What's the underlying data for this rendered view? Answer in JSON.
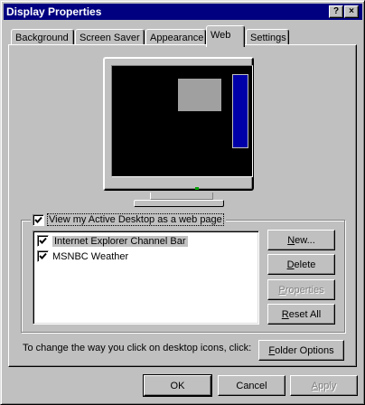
{
  "window": {
    "title": "Display Properties",
    "help_button": "?",
    "close_button": "×"
  },
  "tabs": [
    {
      "label": "Background",
      "active": false
    },
    {
      "label": "Screen Saver",
      "active": false
    },
    {
      "label": "Appearance",
      "active": false
    },
    {
      "label": "Web",
      "active": true
    },
    {
      "label": "Settings",
      "active": false
    }
  ],
  "preview": {
    "screen_color": "#000000",
    "window_color": "#a0a0a0",
    "channel_bar_color": "#0000a8"
  },
  "active_desktop": {
    "checkbox_label": "View my Active Desktop as a web page",
    "checked": true,
    "items": [
      {
        "label": "Internet Explorer Channel Bar",
        "checked": true,
        "selected": true
      },
      {
        "label": "MSNBC Weather",
        "checked": true,
        "selected": false
      }
    ]
  },
  "buttons": {
    "new": "New...",
    "delete": "Delete",
    "properties": "Properties",
    "reset_all": "Reset All",
    "folder_options": "Folder Options"
  },
  "hint_text": "To change the way you click on desktop icons, click:",
  "dialog_buttons": {
    "ok": "OK",
    "cancel": "Cancel",
    "apply": "Apply"
  }
}
